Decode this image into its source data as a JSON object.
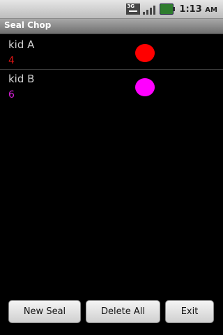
{
  "status_bar": {
    "network_label": "3G",
    "time": "1:13",
    "ampm": "AM",
    "icons": [
      "3g-signal-icon",
      "signal-bars-icon",
      "battery-icon"
    ]
  },
  "app": {
    "title": "Seal Chop"
  },
  "kids": [
    {
      "name": "kid A",
      "count": "4",
      "color": "#ff0000"
    },
    {
      "name": "kid B",
      "count": "6",
      "color": "#ff00ff"
    }
  ],
  "buttons": {
    "new_seal": "New Seal",
    "delete_all": "Delete All",
    "exit": "Exit"
  }
}
